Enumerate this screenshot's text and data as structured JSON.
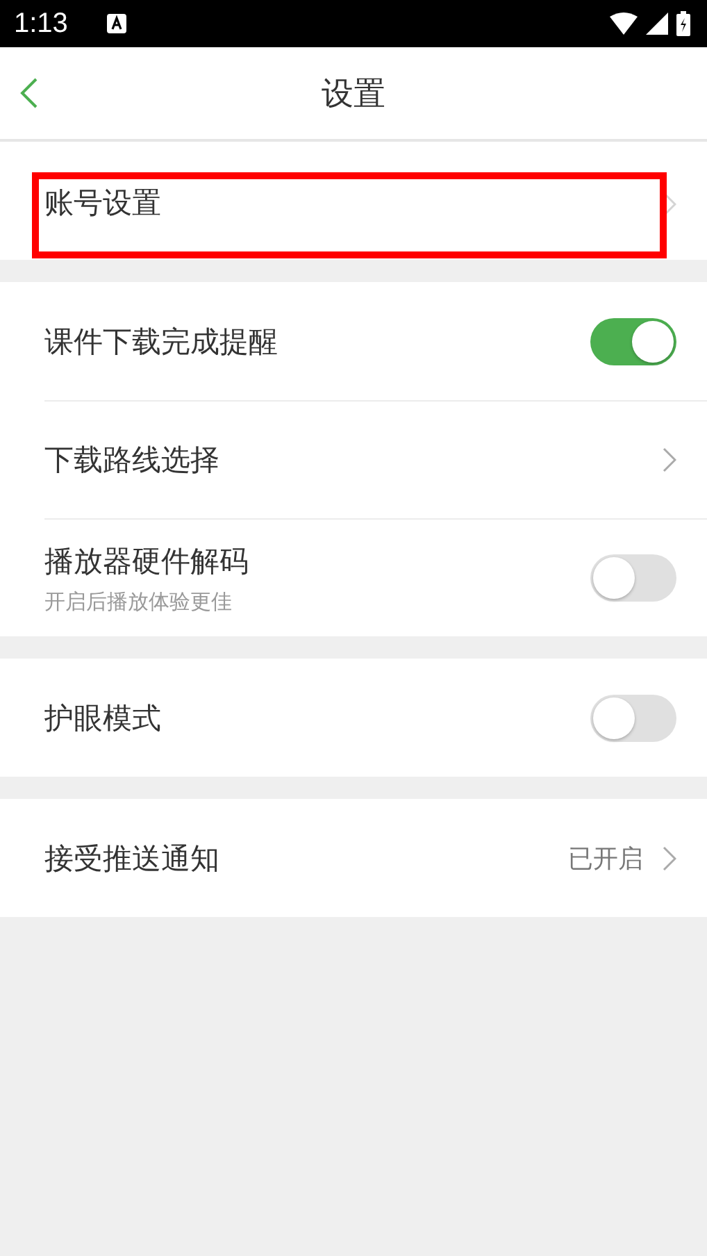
{
  "status_bar": {
    "time": "1:13"
  },
  "nav": {
    "title": "设置"
  },
  "groups": [
    {
      "items": [
        {
          "kind": "link",
          "label": "账号设置",
          "highlighted": true
        }
      ]
    },
    {
      "items": [
        {
          "kind": "toggle",
          "label": "课件下载完成提醒",
          "on": true,
          "highlighted": false
        },
        {
          "kind": "link",
          "label": "下载路线选择",
          "highlighted": false
        },
        {
          "kind": "toggle",
          "label": "播放器硬件解码",
          "subtitle": "开启后播放体验更佳",
          "on": false,
          "highlighted": false
        }
      ]
    },
    {
      "items": [
        {
          "kind": "toggle",
          "label": "护眼模式",
          "on": false,
          "highlighted": false
        }
      ]
    },
    {
      "items": [
        {
          "kind": "link",
          "label": "接受推送通知",
          "value": "已开启",
          "highlighted": false
        }
      ]
    }
  ]
}
